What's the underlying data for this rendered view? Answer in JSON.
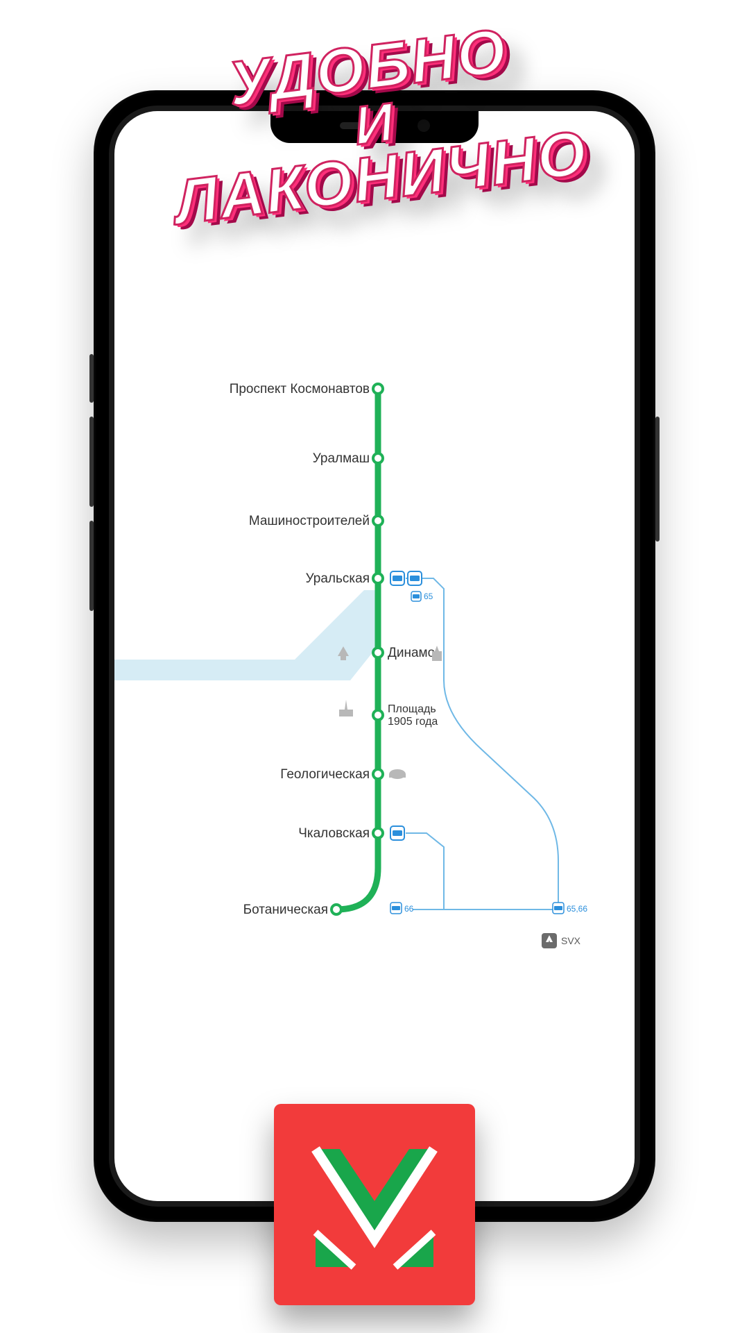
{
  "promo": {
    "line1": "УДОБНО",
    "line2": "И",
    "line3": "ЛАКОНИЧНО"
  },
  "map": {
    "line_color": "#1fb157",
    "river_color": "#d6ecf5",
    "transfer_color": "#2b8fdc",
    "stations": [
      {
        "id": "prospekt",
        "name": "Проспект Космонавтов"
      },
      {
        "id": "uralmash",
        "name": "Уралмаш"
      },
      {
        "id": "mashinostroiteley",
        "name": "Машиностроителей"
      },
      {
        "id": "uralskaya",
        "name": "Уральская"
      },
      {
        "id": "dinamo",
        "name": "Динамо"
      },
      {
        "id": "ploshchad_top",
        "name": "Площадь"
      },
      {
        "id": "ploshchad_bot",
        "name": "1905 года"
      },
      {
        "id": "geologicheskaya",
        "name": "Геологическая"
      },
      {
        "id": "chkalovskaya",
        "name": "Чкаловская"
      },
      {
        "id": "botanicheskaya",
        "name": "Ботаническая"
      }
    ],
    "bus": {
      "route_65": "65",
      "route_66": "66",
      "route_65_66": "65,66"
    },
    "airport": {
      "code": "SVX"
    }
  }
}
